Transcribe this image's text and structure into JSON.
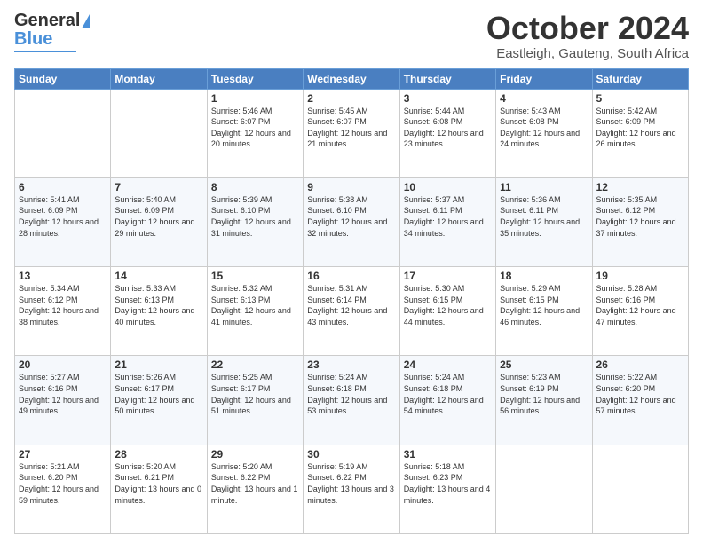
{
  "header": {
    "logo_general": "General",
    "logo_blue": "Blue",
    "month_title": "October 2024",
    "location": "Eastleigh, Gauteng, South Africa"
  },
  "weekdays": [
    "Sunday",
    "Monday",
    "Tuesday",
    "Wednesday",
    "Thursday",
    "Friday",
    "Saturday"
  ],
  "weeks": [
    [
      {
        "day": "",
        "sunrise": "",
        "sunset": "",
        "daylight": ""
      },
      {
        "day": "",
        "sunrise": "",
        "sunset": "",
        "daylight": ""
      },
      {
        "day": "1",
        "sunrise": "Sunrise: 5:46 AM",
        "sunset": "Sunset: 6:07 PM",
        "daylight": "Daylight: 12 hours and 20 minutes."
      },
      {
        "day": "2",
        "sunrise": "Sunrise: 5:45 AM",
        "sunset": "Sunset: 6:07 PM",
        "daylight": "Daylight: 12 hours and 21 minutes."
      },
      {
        "day": "3",
        "sunrise": "Sunrise: 5:44 AM",
        "sunset": "Sunset: 6:08 PM",
        "daylight": "Daylight: 12 hours and 23 minutes."
      },
      {
        "day": "4",
        "sunrise": "Sunrise: 5:43 AM",
        "sunset": "Sunset: 6:08 PM",
        "daylight": "Daylight: 12 hours and 24 minutes."
      },
      {
        "day": "5",
        "sunrise": "Sunrise: 5:42 AM",
        "sunset": "Sunset: 6:09 PM",
        "daylight": "Daylight: 12 hours and 26 minutes."
      }
    ],
    [
      {
        "day": "6",
        "sunrise": "Sunrise: 5:41 AM",
        "sunset": "Sunset: 6:09 PM",
        "daylight": "Daylight: 12 hours and 28 minutes."
      },
      {
        "day": "7",
        "sunrise": "Sunrise: 5:40 AM",
        "sunset": "Sunset: 6:09 PM",
        "daylight": "Daylight: 12 hours and 29 minutes."
      },
      {
        "day": "8",
        "sunrise": "Sunrise: 5:39 AM",
        "sunset": "Sunset: 6:10 PM",
        "daylight": "Daylight: 12 hours and 31 minutes."
      },
      {
        "day": "9",
        "sunrise": "Sunrise: 5:38 AM",
        "sunset": "Sunset: 6:10 PM",
        "daylight": "Daylight: 12 hours and 32 minutes."
      },
      {
        "day": "10",
        "sunrise": "Sunrise: 5:37 AM",
        "sunset": "Sunset: 6:11 PM",
        "daylight": "Daylight: 12 hours and 34 minutes."
      },
      {
        "day": "11",
        "sunrise": "Sunrise: 5:36 AM",
        "sunset": "Sunset: 6:11 PM",
        "daylight": "Daylight: 12 hours and 35 minutes."
      },
      {
        "day": "12",
        "sunrise": "Sunrise: 5:35 AM",
        "sunset": "Sunset: 6:12 PM",
        "daylight": "Daylight: 12 hours and 37 minutes."
      }
    ],
    [
      {
        "day": "13",
        "sunrise": "Sunrise: 5:34 AM",
        "sunset": "Sunset: 6:12 PM",
        "daylight": "Daylight: 12 hours and 38 minutes."
      },
      {
        "day": "14",
        "sunrise": "Sunrise: 5:33 AM",
        "sunset": "Sunset: 6:13 PM",
        "daylight": "Daylight: 12 hours and 40 minutes."
      },
      {
        "day": "15",
        "sunrise": "Sunrise: 5:32 AM",
        "sunset": "Sunset: 6:13 PM",
        "daylight": "Daylight: 12 hours and 41 minutes."
      },
      {
        "day": "16",
        "sunrise": "Sunrise: 5:31 AM",
        "sunset": "Sunset: 6:14 PM",
        "daylight": "Daylight: 12 hours and 43 minutes."
      },
      {
        "day": "17",
        "sunrise": "Sunrise: 5:30 AM",
        "sunset": "Sunset: 6:15 PM",
        "daylight": "Daylight: 12 hours and 44 minutes."
      },
      {
        "day": "18",
        "sunrise": "Sunrise: 5:29 AM",
        "sunset": "Sunset: 6:15 PM",
        "daylight": "Daylight: 12 hours and 46 minutes."
      },
      {
        "day": "19",
        "sunrise": "Sunrise: 5:28 AM",
        "sunset": "Sunset: 6:16 PM",
        "daylight": "Daylight: 12 hours and 47 minutes."
      }
    ],
    [
      {
        "day": "20",
        "sunrise": "Sunrise: 5:27 AM",
        "sunset": "Sunset: 6:16 PM",
        "daylight": "Daylight: 12 hours and 49 minutes."
      },
      {
        "day": "21",
        "sunrise": "Sunrise: 5:26 AM",
        "sunset": "Sunset: 6:17 PM",
        "daylight": "Daylight: 12 hours and 50 minutes."
      },
      {
        "day": "22",
        "sunrise": "Sunrise: 5:25 AM",
        "sunset": "Sunset: 6:17 PM",
        "daylight": "Daylight: 12 hours and 51 minutes."
      },
      {
        "day": "23",
        "sunrise": "Sunrise: 5:24 AM",
        "sunset": "Sunset: 6:18 PM",
        "daylight": "Daylight: 12 hours and 53 minutes."
      },
      {
        "day": "24",
        "sunrise": "Sunrise: 5:24 AM",
        "sunset": "Sunset: 6:18 PM",
        "daylight": "Daylight: 12 hours and 54 minutes."
      },
      {
        "day": "25",
        "sunrise": "Sunrise: 5:23 AM",
        "sunset": "Sunset: 6:19 PM",
        "daylight": "Daylight: 12 hours and 56 minutes."
      },
      {
        "day": "26",
        "sunrise": "Sunrise: 5:22 AM",
        "sunset": "Sunset: 6:20 PM",
        "daylight": "Daylight: 12 hours and 57 minutes."
      }
    ],
    [
      {
        "day": "27",
        "sunrise": "Sunrise: 5:21 AM",
        "sunset": "Sunset: 6:20 PM",
        "daylight": "Daylight: 12 hours and 59 minutes."
      },
      {
        "day": "28",
        "sunrise": "Sunrise: 5:20 AM",
        "sunset": "Sunset: 6:21 PM",
        "daylight": "Daylight: 13 hours and 0 minutes."
      },
      {
        "day": "29",
        "sunrise": "Sunrise: 5:20 AM",
        "sunset": "Sunset: 6:22 PM",
        "daylight": "Daylight: 13 hours and 1 minute."
      },
      {
        "day": "30",
        "sunrise": "Sunrise: 5:19 AM",
        "sunset": "Sunset: 6:22 PM",
        "daylight": "Daylight: 13 hours and 3 minutes."
      },
      {
        "day": "31",
        "sunrise": "Sunrise: 5:18 AM",
        "sunset": "Sunset: 6:23 PM",
        "daylight": "Daylight: 13 hours and 4 minutes."
      },
      {
        "day": "",
        "sunrise": "",
        "sunset": "",
        "daylight": ""
      },
      {
        "day": "",
        "sunrise": "",
        "sunset": "",
        "daylight": ""
      }
    ]
  ]
}
